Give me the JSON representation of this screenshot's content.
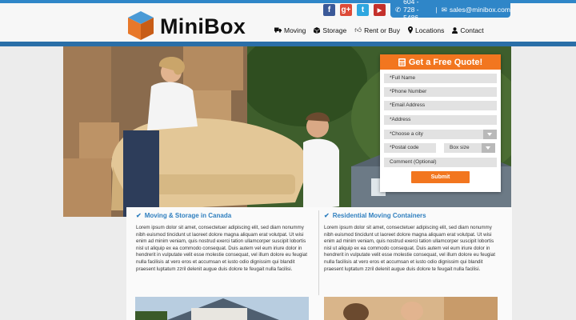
{
  "brand": {
    "name": "MiniBox"
  },
  "social": [
    {
      "name": "facebook",
      "glyph": "f",
      "color": "#3b5998"
    },
    {
      "name": "google-plus",
      "glyph": "g+",
      "color": "#dd4b39"
    },
    {
      "name": "twitter",
      "glyph": "t",
      "color": "#2ea7e0"
    },
    {
      "name": "youtube",
      "glyph": "▶",
      "color": "#c4302b"
    }
  ],
  "contact": {
    "phone": "604 - 728 - 5486",
    "email": "sales@minibox.com"
  },
  "nav": [
    {
      "label": "Moving",
      "icon": "truck-icon"
    },
    {
      "label": "Storage",
      "icon": "box-icon"
    },
    {
      "label": "Rent or Buy",
      "icon": "thumbs-up-icon"
    },
    {
      "label": "Locations",
      "icon": "map-marker-icon"
    },
    {
      "label": "Contact",
      "icon": "user-icon"
    }
  ],
  "quote": {
    "title": "Get a Free Quote!",
    "full_name": "*Full Name",
    "phone": "*Phone Number",
    "email": "*Email Address",
    "address": "*Address",
    "city": "*Choose a city",
    "postal": "*Postal code",
    "box_size": "Box size",
    "comment": "Comment (Optional)",
    "submit": "Submit"
  },
  "sections": [
    {
      "title": "Moving & Storage in Canada",
      "body": "Lorem ipsum dolor sit amet, consectetuer adipiscing elit, sed diam nonummy nibh euismod tincidunt ut laoreet dolore magna aliquam erat volutpat. Ut wisi enim ad minim veniam, quis nostrud exerci tation ullamcorper suscipit lobortis nisl ut aliquip ex ea commodo consequat. Duis autem vel eum iriure dolor in hendrerit in vulputate velit esse molestie consequat, vel illum dolore eu feugiat nulla facilisis at vero eros et accumsan et iusto odio dignissim qui blandit praesent luptatum zzril delenit augue duis dolore te feugait nulla facilisi."
    },
    {
      "title": "Residential Moving Containers",
      "body": "Lorem ipsum dolor sit amet, consectetuer adipiscing elit, sed diam nonummy nibh euismod tincidunt ut laoreet dolore magna aliquam erat volutpat. Ut wisi enim ad minim veniam, quis nostrud exerci tation ullamcorper suscipit lobortis nisl ut aliquip ex ea commodo consequat. Duis autem vel eum iriure dolor in hendrerit in vulputate velit esse molestie consequat, vel illum dolore eu feugiat nulla facilisis at vero eros et accumsan et iusto odio dignissim qui blandit praesent luptatum zzril delenit augue duis dolore te feugait nulla facilisi."
    }
  ],
  "colors": {
    "accent": "#2f86c8",
    "orange": "#f2761f",
    "heading": "#2f7fbf"
  }
}
